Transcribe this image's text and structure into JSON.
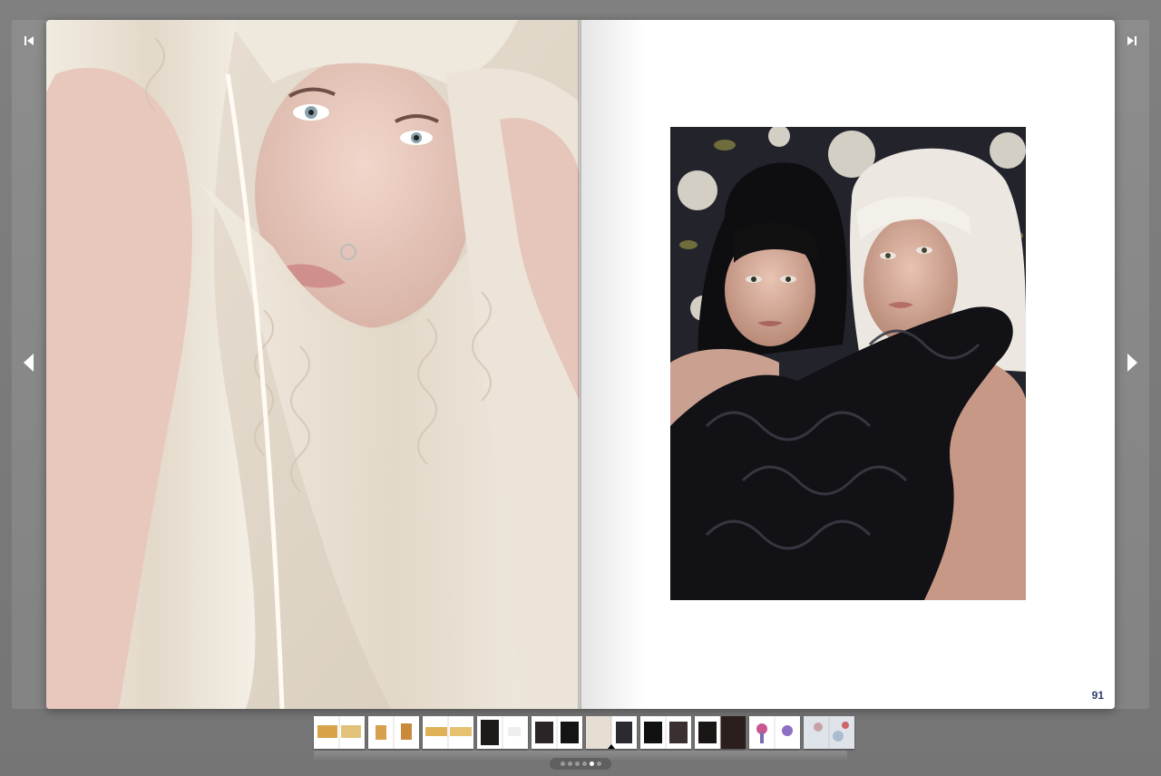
{
  "viewer": {
    "page_number": "91",
    "nav_icons": {
      "first": "skip-to-first-icon",
      "last": "skip-to-last-icon",
      "prev": "previous-page-icon",
      "next": "next-page-icon"
    },
    "thumbnails": [
      {
        "id": "spread-1",
        "active": false
      },
      {
        "id": "spread-2",
        "active": false
      },
      {
        "id": "spread-3",
        "active": false
      },
      {
        "id": "spread-4",
        "active": false
      },
      {
        "id": "spread-5",
        "active": false
      },
      {
        "id": "spread-6",
        "active": true
      },
      {
        "id": "spread-7",
        "active": false
      },
      {
        "id": "spread-8",
        "active": false
      },
      {
        "id": "spread-9",
        "active": false
      },
      {
        "id": "spread-10",
        "active": false
      }
    ],
    "pager": {
      "count": 6,
      "active_index": 4
    },
    "colors": {
      "background": "#7b7b7b",
      "page": "#ffffff",
      "page_number": "#2d3f6e"
    }
  }
}
